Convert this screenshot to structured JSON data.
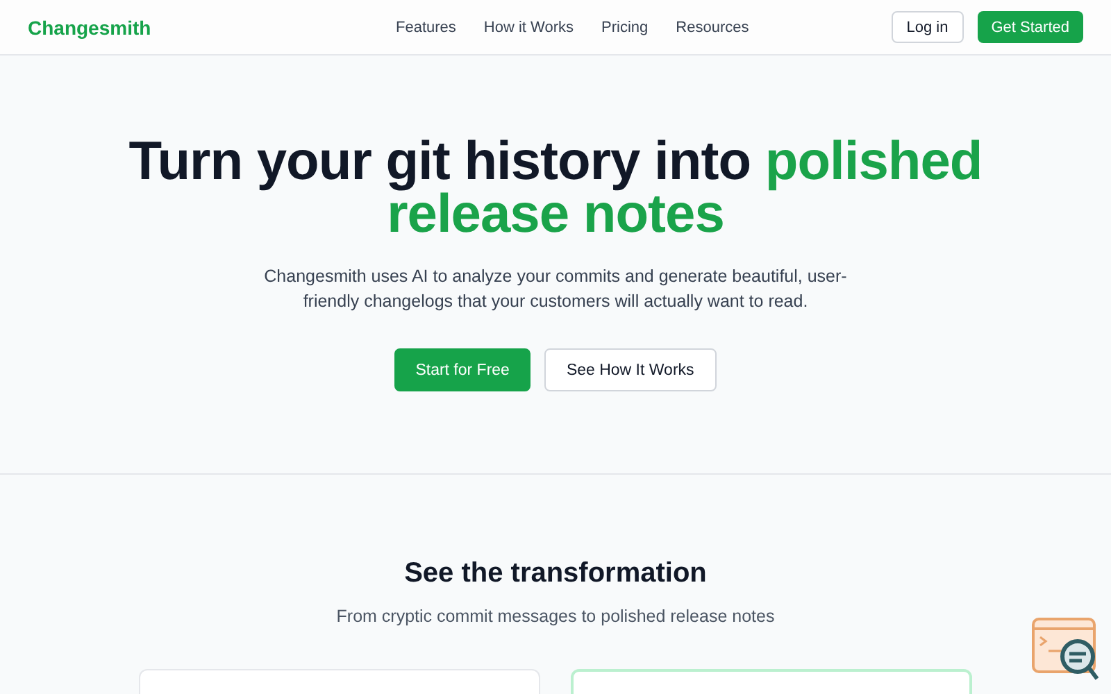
{
  "nav": {
    "brand": "Changesmith",
    "links": [
      "Features",
      "How it Works",
      "Pricing",
      "Resources"
    ],
    "login": "Log in",
    "cta": "Get Started"
  },
  "hero": {
    "title": "Turn your git history into",
    "title_highlight": "polished release notes",
    "subtitle": "Changesmith uses AI to analyze your commits and generate beautiful, user-friendly changelogs that your customers will actually want to read.",
    "buttons": [
      {
        "label": "Start for Free",
        "kind": "primary"
      },
      {
        "label": "See How It Works",
        "kind": "secondary"
      }
    ]
  },
  "transformation": {
    "title": "See the transformation",
    "subtitle": "From cryptic commit messages to polished release notes",
    "cards": [
      {
        "highlighted": false
      },
      {
        "highlighted": true
      }
    ]
  }
}
